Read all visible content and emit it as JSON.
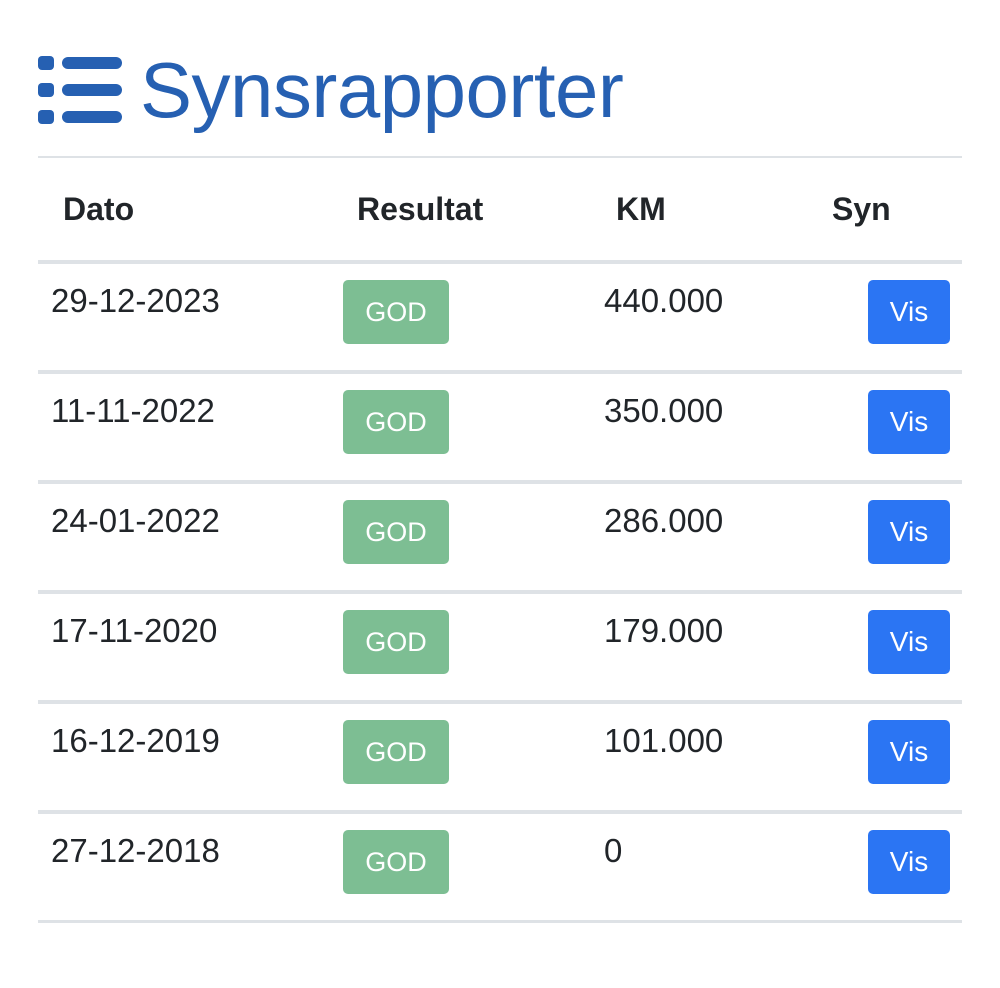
{
  "header": {
    "icon": "list-icon",
    "title": "Synsrapporter"
  },
  "colors": {
    "title": "#2660b2",
    "badge_good": "#7dbe93",
    "button_primary": "#2b75f3",
    "rule": "#dee2e6"
  },
  "table": {
    "columns": [
      "Dato",
      "Resultat",
      "KM",
      "Syn"
    ],
    "rows": [
      {
        "date": "29-12-2023",
        "result": "GOD",
        "km": "440.000",
        "action": "Vis"
      },
      {
        "date": "11-11-2022",
        "result": "GOD",
        "km": "350.000",
        "action": "Vis"
      },
      {
        "date": "24-01-2022",
        "result": "GOD",
        "km": "286.000",
        "action": "Vis"
      },
      {
        "date": "17-11-2020",
        "result": "GOD",
        "km": "179.000",
        "action": "Vis"
      },
      {
        "date": "16-12-2019",
        "result": "GOD",
        "km": "101.000",
        "action": "Vis"
      },
      {
        "date": "27-12-2018",
        "result": "GOD",
        "km": "0",
        "action": "Vis"
      }
    ]
  }
}
